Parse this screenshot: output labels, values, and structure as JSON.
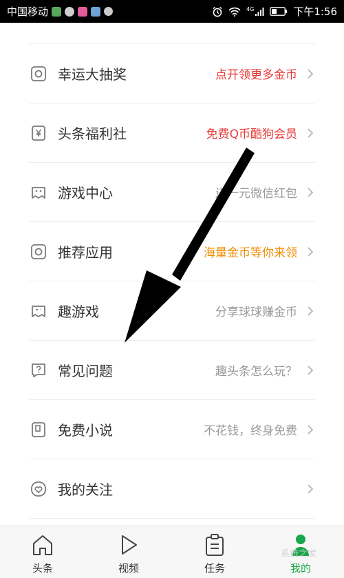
{
  "status_bar": {
    "carrier": "中国移动",
    "network": "4G",
    "time": "下午1:56"
  },
  "menu": {
    "items": [
      {
        "label": "幸运大抽奖",
        "sub": "点开领更多金币",
        "icon": "circle-square-icon",
        "sub_style": "red"
      },
      {
        "label": "头条福利社",
        "sub": "免费Q币酷狗会员",
        "icon": "yen-icon",
        "sub_style": "red"
      },
      {
        "label": "游戏中心",
        "sub": "送一元微信红包",
        "icon": "gamepad-icon",
        "sub_style": "gray"
      },
      {
        "label": "推荐应用",
        "sub": "海量金币等你来领",
        "icon": "app-icon",
        "sub_style": "orange"
      },
      {
        "label": "趣游戏",
        "sub": "分享球球赚金币",
        "icon": "game-controller-icon",
        "sub_style": "gray"
      },
      {
        "label": "常见问题",
        "sub": "趣头条怎么玩？",
        "icon": "question-icon",
        "sub_style": "gray"
      },
      {
        "label": "免费小说",
        "sub": "不花钱，终身免费",
        "icon": "book-icon",
        "sub_style": "gray"
      },
      {
        "label": "我的关注",
        "sub": "",
        "icon": "heart-icon",
        "sub_style": "gray"
      }
    ]
  },
  "tabbar": {
    "tabs": [
      {
        "label": "头条",
        "icon": "home-icon",
        "active": false
      },
      {
        "label": "视频",
        "icon": "play-icon",
        "active": false
      },
      {
        "label": "任务",
        "icon": "clipboard-icon",
        "active": false
      },
      {
        "label": "我的",
        "icon": "user-icon",
        "active": true
      }
    ]
  },
  "watermark": "系统之家",
  "colors": {
    "accent_green": "#1aa64a",
    "sub_red": "#e53935",
    "sub_orange": "#f08c00"
  }
}
